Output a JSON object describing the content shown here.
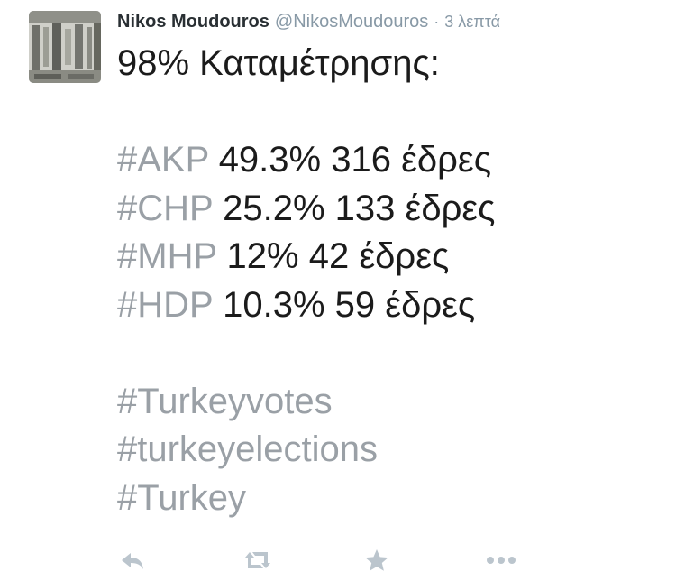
{
  "tweet": {
    "author": {
      "name": "Nikos Moudouros",
      "handle": "@NikosMoudouros",
      "separator": "·",
      "time": "3 λεπτά"
    },
    "heading": "98% Καταμέτρησης:",
    "results": [
      {
        "tag": "#AKP",
        "value": "49.3% 316 έδρες"
      },
      {
        "tag": "#CHP",
        "value": "25.2% 133 έδρες"
      },
      {
        "tag": "#MHP",
        "value": "12% 42 έδρες"
      },
      {
        "tag": "#HDP",
        "value": "10.3% 59 έδρες"
      }
    ],
    "hashtags": [
      "#Turkeyvotes",
      "#turkeyelections",
      "#Turkey"
    ]
  },
  "actions": {
    "reply": "reply-icon",
    "retweet": "retweet-icon",
    "favorite": "star-icon",
    "more": "more-icon",
    "icon_color": "#bbc5cd"
  }
}
